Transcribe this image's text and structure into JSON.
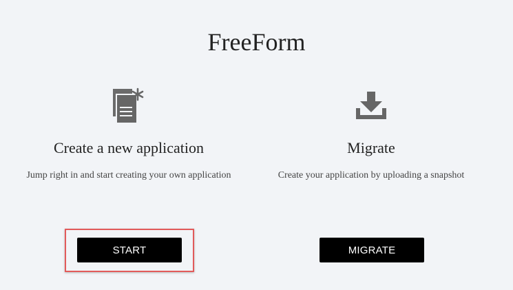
{
  "app": {
    "title": "FreeForm"
  },
  "cards": {
    "create": {
      "icon": "new-document-icon",
      "title": "Create a new application",
      "description": "Jump right in and start creating your own application",
      "button_label": "START"
    },
    "migrate": {
      "icon": "download-icon",
      "title": "Migrate",
      "description": "Create your application by uploading a snapshot",
      "button_label": "MIGRATE"
    }
  },
  "colors": {
    "background": "#f2f4f7",
    "button": "#000000",
    "icon": "#666666",
    "highlight": "#e25a5a"
  }
}
